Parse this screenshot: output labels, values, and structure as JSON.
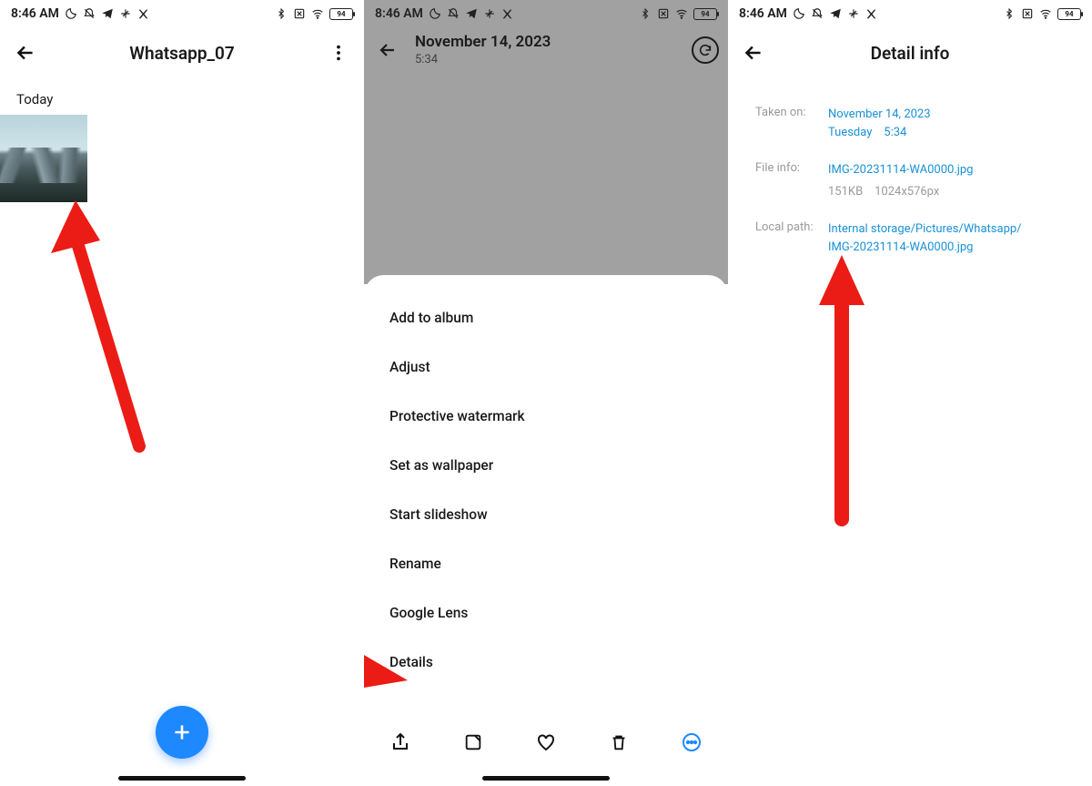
{
  "status": {
    "time": "8:46 AM",
    "battery": "94"
  },
  "screen1": {
    "title": "Whatsapp_07",
    "section": "Today"
  },
  "screen2": {
    "date": "November 14, 2023",
    "time": "5:34",
    "menu": {
      "add_album": "Add to album",
      "adjust": "Adjust",
      "watermark": "Protective watermark",
      "wallpaper": "Set as wallpaper",
      "slideshow": "Start slideshow",
      "rename": "Rename",
      "lens": "Google Lens",
      "details": "Details"
    }
  },
  "screen3": {
    "title": "Detail info",
    "taken_on_k": "Taken on:",
    "taken_on_date": "November 14, 2023",
    "taken_on_day": "Tuesday",
    "taken_on_time": "5:34",
    "file_info_k": "File info:",
    "file_name": "IMG-20231114-WA0000.jpg",
    "file_size": "151KB",
    "file_dims": "1024x576px",
    "local_path_k": "Local path:",
    "local_path_1": "Internal storage/Pictures/Whatsapp/",
    "local_path_2": "IMG-20231114-WA0000.jpg"
  }
}
